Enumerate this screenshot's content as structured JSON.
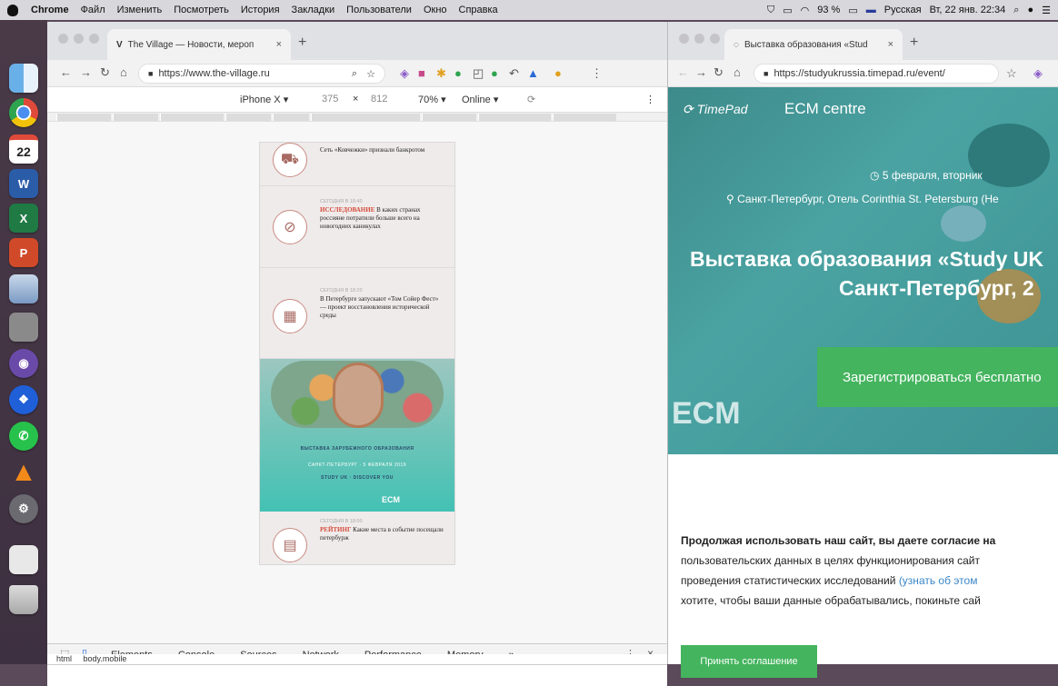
{
  "menubar": {
    "items": [
      "Chrome",
      "Файл",
      "Изменить",
      "Посмотреть",
      "История",
      "Закладки",
      "Пользователи",
      "Окно",
      "Справка"
    ],
    "battery": "93 %",
    "input_lang": "Русская",
    "datetime": "Вт, 22 янв. 22:34"
  },
  "dock": [
    "Finder",
    "Chrome",
    "Calendar",
    "Word",
    "Excel",
    "PowerPoint",
    "Preview",
    "Notes",
    "GitHub",
    "Dropbox",
    "WhatsApp",
    "VLC",
    "System Preferences",
    "Trash"
  ],
  "dock_calendar_day": "22",
  "left_window": {
    "tab_title": "The Village — Новости, мероп",
    "url": "https://www.the-village.ru",
    "device": "iPhone X ▾",
    "width": "375",
    "times": "×",
    "height": "812",
    "zoom": "70% ▾",
    "throttle": "Online ▾",
    "articles": [
      {
        "meta": "",
        "text": "Сеть «Ковчежки» признали банкротом"
      },
      {
        "meta": "СЕГОДНЯ В 18:40",
        "tag": "ИССЛЕДОВАНИЕ",
        "text": "В каких странах россияне потратили больше всего на новогодних каникулах"
      },
      {
        "meta": "СЕГОДНЯ В 18:20",
        "text": "В Петербурге запускают «Том Сойер Фест» — проект восстановления исторической среды"
      },
      {
        "meta": "СЕГОДНЯ В 18:00",
        "tag": "РЕЙТИНГ",
        "text": "Какие места в событие посещали петербурж"
      }
    ],
    "banner": {
      "line1": "ВЫСТАВКА ЗАРУБЕЖНОГО ОБРАЗОВАНИЯ",
      "line2": "САНКТ-ПЕТЕРБУРГ · 5 ФЕВРАЛЯ 2019",
      "line3": "STUDY UK · DISCOVER YOU",
      "ecm": "ECM"
    },
    "devtools": {
      "tabs": [
        "Elements",
        "Console",
        "Sources",
        "Network",
        "Performance",
        "Memory",
        "»"
      ],
      "crumb_html": "html",
      "crumb_body": "body.mobile"
    }
  },
  "right_window": {
    "tab_title": "Выставка образования «Stud",
    "url": "https://studyukrussia.timepad.ru/event/",
    "logo": "TimePad",
    "organizer": "ECM centre",
    "date": "5 февраля, вторник",
    "place": "Санкт-Петербург, Отель Corinthia St. Petersburg (Не",
    "title_line1": "Выставка образования «Study UK",
    "title_line2": "Санкт-Петербург, 2",
    "register": "Зарегистрироваться бесплатно",
    "ecm": "ECM",
    "cookie": {
      "line1": "Продолжая использовать наш сайт, вы даете согласие на",
      "line2": "пользовательских данных в целях функционирования сайт",
      "line3": "проведения статистических исследований",
      "link": "(узнать об этом",
      "line4": "хотите, чтобы ваши данные обрабатывались, покиньте сай",
      "accept": "Принять соглашение"
    }
  }
}
